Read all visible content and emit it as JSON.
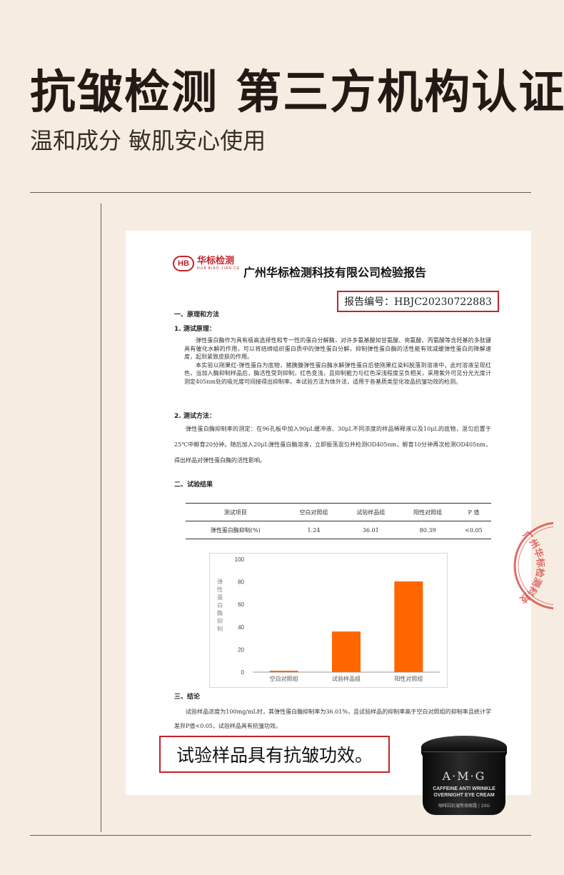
{
  "header": {
    "title": "抗皱检测 第三方机构认证",
    "subtitle": "温和成分 敏肌安心使用"
  },
  "report": {
    "logo_mark": "HB",
    "logo_cn": "华标检测",
    "logo_en": "HUA BIAO JIAN CE",
    "company": "广州华标检测科技有限公司检验报告",
    "report_no": "报告编号：HBJC20230722883",
    "section1": "一、原理和方法",
    "s1_sub1": "1. 测试原理：",
    "principle_p1": "弹性蛋白酶作为具有极高选择性和专一性的蛋白分解酶，对许多氨基酸如甘氨酸、亮氨酸、丙氨酸等含羟基的多肽键具有催化水解的作用，可以将结缔组织蛋白质中的弹性蛋白分解。抑制弹性蛋白酶的活性能有效减缓弹性蛋白的降解速度，起到紧致皮肤的作用。",
    "principle_p2": "本实验以刚果红-弹性蛋白为底物，猪胰腺弹性蛋白酶水解弹性蛋白后使刚果红染料脱落到溶液中，此时溶液呈现红色，当加入酶抑制样品后，酶活性受到抑制，红色变浅，且抑制能力与红色深浅程度呈负相关，采用紫外可见分光光度计测定405nm处的吸光度可间接得出抑制率。本试验方法为体外法，适用于各基质类型化妆品抗皱功效的检测。",
    "s1_sub2": "2. 测试方法：",
    "method_p": "弹性蛋白酶抑制率的测定：在96孔板中加入90μL缓冲液、30μL不同浓度的样品稀释液以及10μL的底物，混匀后置于25℃中孵育20分钟。随后加入20μL弹性蛋白酶溶液，立即振荡混匀并检测OD405nm，孵育10分钟再次检测OD405nm，得出样品对弹性蛋白酶的活性影响。",
    "section2": "二、试验结果",
    "table": {
      "headers": [
        "测试项目",
        "空白对照组",
        "试验样品组",
        "阳性对照组",
        "P 值"
      ],
      "row": [
        "弹性蛋白酶抑制(%)",
        "1.24",
        "36.01",
        "80.39",
        "<0.05"
      ]
    },
    "section3": "三、结论",
    "conclusion_p": "试验样品浓度为100mg/mL时，其弹性蛋白酶抑制率为36.01%，且试验样品的抑制率高于空白对照组的抑制率且统计学差异P值<0.05，试验样品具有抗皱功效。",
    "conclusion_box": "试验样品具有抗皱功效。",
    "stamp_text": "广州华标检测科技有限公司"
  },
  "chart_data": {
    "type": "bar",
    "categories": [
      "空白对照组",
      "试验样品组",
      "阳性对照组"
    ],
    "values": [
      1.24,
      36.01,
      80.39
    ],
    "ylabel": "弹性蛋白酶抑制",
    "yticks": [
      0,
      20,
      40,
      60,
      80,
      100
    ],
    "ylim": [
      0,
      100
    ],
    "grid": false,
    "bar_color": "#ff6600"
  },
  "product": {
    "brand": "A·M·G",
    "line1": "CAFFEINE ANTI WRINKLE",
    "line2": "OVERNIGHT EYE CREAM",
    "bottom": "咖啡因抗皱熬夜眼霜 | 20G"
  }
}
